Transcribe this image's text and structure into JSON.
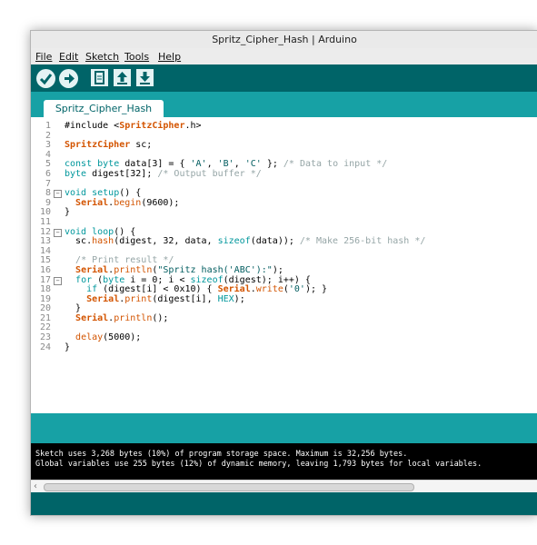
{
  "window": {
    "title": "Spritz_Cipher_Hash | Arduino"
  },
  "menu": [
    "File",
    "Edit",
    "Sketch",
    "Tools",
    "Help"
  ],
  "toolbar": {
    "icons": [
      "verify-icon",
      "upload-icon",
      "new-icon",
      "open-icon",
      "save-icon"
    ]
  },
  "tab": {
    "label": "Spritz_Cipher_Hash"
  },
  "editor": {
    "line_numbers": [
      "1",
      "2",
      "3",
      "4",
      "5",
      "6",
      "7",
      "8",
      "9",
      "10",
      "11",
      "12",
      "13",
      "14",
      "15",
      "16",
      "17",
      "18",
      "19",
      "20",
      "21",
      "22",
      "23",
      "24"
    ],
    "lines": [
      {
        "parts": [
          [
            "t",
            "#include <"
          ],
          [
            "lib",
            "SpritzCipher"
          ],
          [
            "t",
            ".h>"
          ]
        ]
      },
      {
        "parts": []
      },
      {
        "parts": [
          [
            "lib",
            "SpritzCipher"
          ],
          [
            "t",
            " sc;"
          ]
        ]
      },
      {
        "parts": []
      },
      {
        "parts": [
          [
            "kw",
            "const"
          ],
          [
            "t",
            " "
          ],
          [
            "kw",
            "byte"
          ],
          [
            "t",
            " data[3] = { "
          ],
          [
            "str",
            "'A'"
          ],
          [
            "t",
            ", "
          ],
          [
            "str",
            "'B'"
          ],
          [
            "t",
            ", "
          ],
          [
            "str",
            "'C'"
          ],
          [
            "t",
            " }; "
          ],
          [
            "cmt",
            "/* Data to input */"
          ]
        ]
      },
      {
        "parts": [
          [
            "kw",
            "byte"
          ],
          [
            "t",
            " digest[32]; "
          ],
          [
            "cmt",
            "/* Output buffer */"
          ]
        ]
      },
      {
        "parts": []
      },
      {
        "parts": [
          [
            "kw",
            "void"
          ],
          [
            "t",
            " "
          ],
          [
            "kw",
            "setup"
          ],
          [
            "t",
            "() {"
          ]
        ]
      },
      {
        "parts": [
          [
            "t",
            "  "
          ],
          [
            "lib",
            "Serial"
          ],
          [
            "t",
            "."
          ],
          [
            "fn",
            "begin"
          ],
          [
            "t",
            "(9600);"
          ]
        ]
      },
      {
        "parts": [
          [
            "t",
            "}"
          ]
        ]
      },
      {
        "parts": []
      },
      {
        "parts": [
          [
            "kw",
            "void"
          ],
          [
            "t",
            " "
          ],
          [
            "kw",
            "loop"
          ],
          [
            "t",
            "() {"
          ]
        ]
      },
      {
        "parts": [
          [
            "t",
            "  sc."
          ],
          [
            "fn",
            "hash"
          ],
          [
            "t",
            "(digest, 32, data, "
          ],
          [
            "kw",
            "sizeof"
          ],
          [
            "t",
            "(data)); "
          ],
          [
            "cmt",
            "/* Make 256-bit hash */"
          ]
        ]
      },
      {
        "parts": []
      },
      {
        "parts": [
          [
            "t",
            "  "
          ],
          [
            "cmt",
            "/* Print result */"
          ]
        ]
      },
      {
        "parts": [
          [
            "t",
            "  "
          ],
          [
            "lib",
            "Serial"
          ],
          [
            "t",
            "."
          ],
          [
            "fn",
            "println"
          ],
          [
            "t",
            "("
          ],
          [
            "str",
            "\"Spritz hash('ABC'):\""
          ],
          [
            "t",
            ");"
          ]
        ]
      },
      {
        "parts": [
          [
            "t",
            "  "
          ],
          [
            "kw",
            "for"
          ],
          [
            "t",
            " ("
          ],
          [
            "kw",
            "byte"
          ],
          [
            "t",
            " i = 0; i < "
          ],
          [
            "kw",
            "sizeof"
          ],
          [
            "t",
            "(digest); i++) {"
          ]
        ]
      },
      {
        "parts": [
          [
            "t",
            "    "
          ],
          [
            "kw",
            "if"
          ],
          [
            "t",
            " (digest[i] < 0x10) { "
          ],
          [
            "lib",
            "Serial"
          ],
          [
            "t",
            "."
          ],
          [
            "fn",
            "write"
          ],
          [
            "t",
            "("
          ],
          [
            "str",
            "'0'"
          ],
          [
            "t",
            "); }"
          ]
        ]
      },
      {
        "parts": [
          [
            "t",
            "    "
          ],
          [
            "lib",
            "Serial"
          ],
          [
            "t",
            "."
          ],
          [
            "fn",
            "print"
          ],
          [
            "t",
            "(digest[i], "
          ],
          [
            "kw",
            "HEX"
          ],
          [
            "t",
            ");"
          ]
        ]
      },
      {
        "parts": [
          [
            "t",
            "  }"
          ]
        ]
      },
      {
        "parts": [
          [
            "t",
            "  "
          ],
          [
            "lib",
            "Serial"
          ],
          [
            "t",
            "."
          ],
          [
            "fn",
            "println"
          ],
          [
            "t",
            "();"
          ]
        ]
      },
      {
        "parts": []
      },
      {
        "parts": [
          [
            "t",
            "  "
          ],
          [
            "fn",
            "delay"
          ],
          [
            "t",
            "(5000);"
          ]
        ]
      },
      {
        "parts": [
          [
            "t",
            "}"
          ]
        ]
      }
    ]
  },
  "console": {
    "lines": [
      "Sketch uses 3,268 bytes (10%) of program storage space. Maximum is 32,256 bytes.",
      "Global variables use 255 bytes (12%) of dynamic memory, leaving 1,793 bytes for local variables."
    ]
  },
  "colors": {
    "toolbar_bg": "#006468",
    "tabstrip_bg": "#17a1a5",
    "keyword": "#00979c",
    "library": "#d35400",
    "comment": "#95a5a6"
  }
}
